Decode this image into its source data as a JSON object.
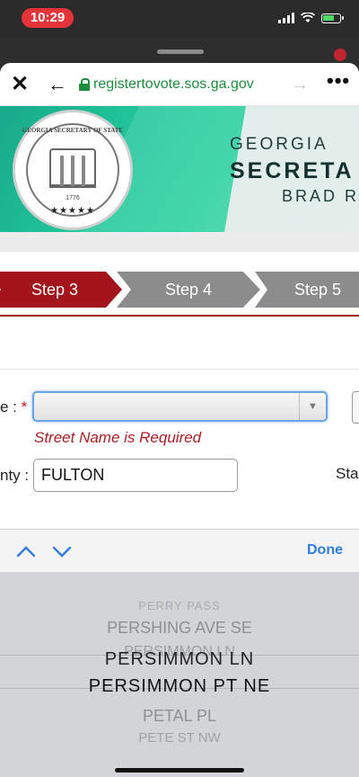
{
  "status_bar": {
    "time": "10:29"
  },
  "browser": {
    "url": "registertovote.sos.ga.gov"
  },
  "banner": {
    "line1": "GEORGIA",
    "line2": "SECRETA",
    "line3": "BRAD R",
    "seal_text": "GEORGIA SECRETARY OF STATE",
    "seal_year": "1776",
    "seal_stars": "★★★★★"
  },
  "steps": [
    {
      "label": "Step 3",
      "active": true
    },
    {
      "label": "Step 4",
      "active": false
    },
    {
      "label": "Step 5",
      "active": false
    }
  ],
  "form": {
    "street_label": "e : ",
    "required_mark": "*",
    "street_value": "",
    "street_error": "Street Name is Required",
    "county_label": "nty : ",
    "county_value": "FULTON",
    "state_label": "Sta"
  },
  "toolbar": {
    "done_label": "Done"
  },
  "picker": {
    "items": [
      "PERRY PASS",
      "PERSHING AVE SE",
      "PERSIMMON LN",
      "PERSIMMON LN",
      "PERSIMMON PT NE",
      "PETAL PL",
      "PETE ST NW"
    ]
  },
  "colors": {
    "accent_red": "#a3141c",
    "url_green": "#1b8f3a",
    "link_blue": "#2f7de1",
    "step_gray": "#8c8c8c"
  }
}
